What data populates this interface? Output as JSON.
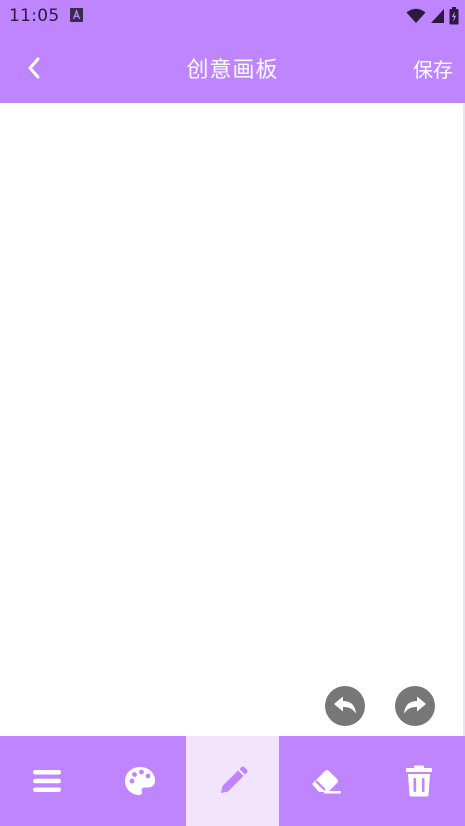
{
  "status_bar": {
    "time": "11:05",
    "notification_icon": "a-letter-icon",
    "wifi_icon": "wifi-icon",
    "signal_icon": "cell-signal-icon",
    "battery_icon": "battery-charging-icon"
  },
  "app_bar": {
    "back_icon": "chevron-left-icon",
    "title": "创意画板",
    "save_label": "保存",
    "background": "#bf85ff"
  },
  "canvas": {
    "undo_icon": "undo-icon",
    "redo_icon": "redo-icon",
    "control_color": "#777777"
  },
  "toolbar": {
    "items": [
      {
        "name": "menu",
        "icon": "menu-icon",
        "active": false
      },
      {
        "name": "palette",
        "icon": "palette-icon",
        "active": false
      },
      {
        "name": "pencil",
        "icon": "pencil-icon",
        "active": true
      },
      {
        "name": "eraser",
        "icon": "eraser-icon",
        "active": false
      },
      {
        "name": "trash",
        "icon": "trash-icon",
        "active": false
      }
    ],
    "background": "#bf85ff",
    "active_background": "#f3e4fe",
    "active_icon_color": "#bf85ff"
  }
}
